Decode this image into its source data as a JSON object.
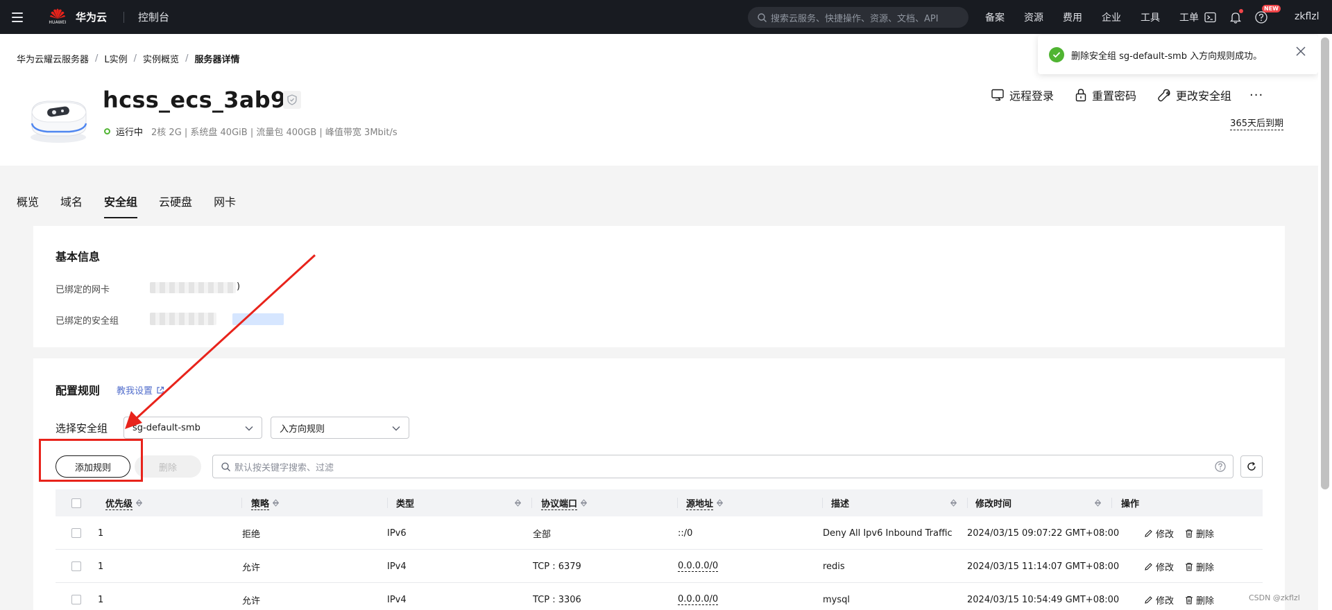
{
  "topnav": {
    "logo_text": "HUAWEI",
    "brand": "华为云",
    "console": "控制台",
    "search_placeholder": "搜索云服务、快捷操作、资源、文档、API",
    "links": [
      "备案",
      "资源",
      "费用",
      "企业",
      "工具",
      "工单"
    ],
    "new_badge": "NEW",
    "username": "zkflzl"
  },
  "breadcrumb": [
    "华为云耀云服务器",
    "L实例",
    "实例概览",
    "服务器详情"
  ],
  "server": {
    "name": "hcss_ecs_3ab9",
    "status": "运行中",
    "specs": "2核  2G | 系统盘 40GiB | 流量包 400GB | 峰值带宽 3Mbit/s",
    "expire": "365天后到期"
  },
  "actions": {
    "remote_login": "远程登录",
    "reset_password": "重置密码",
    "change_sg": "更改安全组",
    "more": "···"
  },
  "toast": {
    "message": "删除安全组 sg-default-smb 入方向规则成功。"
  },
  "tabs": [
    "概览",
    "域名",
    "安全组",
    "云硬盘",
    "网卡"
  ],
  "basic_info": {
    "title": "基本信息",
    "nic_label": "已绑定的网卡",
    "nic_suffix": ")",
    "sg_label": "已绑定的安全组"
  },
  "rules": {
    "title": "配置规则",
    "guide_link": "教我设置",
    "select_label": "选择安全组",
    "sg_value": "sg-default-smb",
    "direction_value": "入方向规则",
    "add_button": "添加规则",
    "delete_button": "删除",
    "search_placeholder": "默认按关键字搜索、过滤",
    "columns": [
      "优先级",
      "策略",
      "类型",
      "协议端口",
      "源地址",
      "描述",
      "修改时间",
      "操作"
    ],
    "op_edit": "修改",
    "op_delete": "删除",
    "rows": [
      {
        "priority": "1",
        "policy": "拒绝",
        "type": "IPv6",
        "port": "全部",
        "source": "::/0",
        "desc": "Deny All Ipv6 Inbound Traffic",
        "time": "2024/03/15 09:07:22 GMT+08:00"
      },
      {
        "priority": "1",
        "policy": "允许",
        "type": "IPv4",
        "port": "TCP : 6379",
        "source": "0.0.0.0/0",
        "desc": "redis",
        "time": "2024/03/15 11:14:07 GMT+08:00"
      },
      {
        "priority": "1",
        "policy": "允许",
        "type": "IPv4",
        "port": "TCP : 3306",
        "source": "0.0.0.0/0",
        "desc": "mysql",
        "time": "2024/03/15 10:54:49 GMT+08:00"
      }
    ]
  },
  "watermark": "CSDN @zkflzl",
  "colors": {
    "nav_bg": "#181b21",
    "status_green": "#50b432",
    "link_blue": "#526ecc",
    "annotation_red": "#e8231b"
  }
}
